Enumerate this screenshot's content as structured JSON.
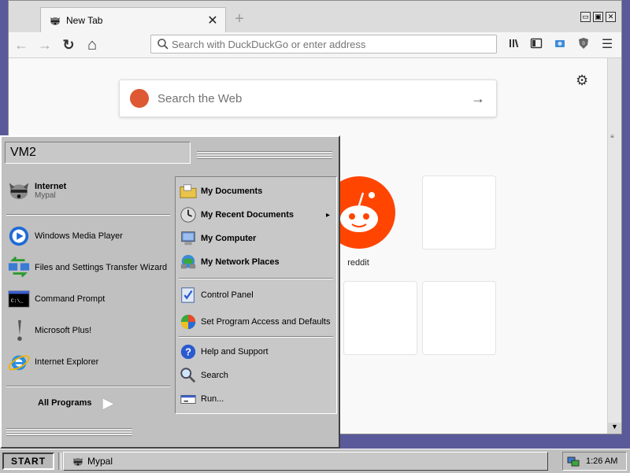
{
  "browser": {
    "tab": {
      "title": "New Tab",
      "close": "✕",
      "icon": "raccoon-icon"
    },
    "new_tab": "+",
    "window_controls": [
      "▭",
      "▣",
      "✕"
    ],
    "nav": {
      "back": "←",
      "forward": "→",
      "reload": "↻",
      "home": "⌂"
    },
    "url_placeholder": "Search with DuckDuckGo or enter address",
    "toolbar_icons": [
      "library-icon",
      "sidebar-icon",
      "screenshot-icon",
      "ublock-icon",
      "menu-icon"
    ]
  },
  "newtab": {
    "search_placeholder": "Search the Web",
    "search_arrow": "→",
    "settings": "⚙",
    "top_sites": [
      {
        "label": "reddit",
        "color": "#ff4500"
      }
    ]
  },
  "start_menu": {
    "user": "VM2",
    "pinned": [
      {
        "title": "Internet",
        "subtitle": "Mypal",
        "icon": "raccoon-icon"
      }
    ],
    "recent": [
      {
        "label": "Windows Media Player",
        "icon": "media-player-icon"
      },
      {
        "label": "Files and Settings Transfer Wizard",
        "icon": "transfer-wizard-icon"
      },
      {
        "label": "Command Prompt",
        "icon": "command-prompt-icon"
      },
      {
        "label": "Microsoft Plus!",
        "icon": "plus-icon"
      },
      {
        "label": "Internet Explorer",
        "icon": "internet-explorer-icon"
      }
    ],
    "all_programs": "All Programs",
    "right": [
      {
        "label": "My Documents",
        "bold": true,
        "icon": "folder-icon"
      },
      {
        "label": "My Recent Documents",
        "bold": true,
        "icon": "recent-docs-icon",
        "arrow": "▸"
      },
      {
        "label": "My Computer",
        "bold": true,
        "icon": "computer-icon"
      },
      {
        "label": "My Network Places",
        "bold": true,
        "icon": "network-icon"
      },
      {
        "label": "Control Panel",
        "bold": false,
        "icon": "control-panel-icon"
      },
      {
        "label": "Set Program Access and Defaults",
        "bold": false,
        "icon": "program-access-icon"
      },
      {
        "label": "Help and Support",
        "bold": false,
        "icon": "help-icon"
      },
      {
        "label": "Search",
        "bold": false,
        "icon": "search-icon"
      },
      {
        "label": "Run...",
        "bold": false,
        "icon": "run-icon"
      }
    ]
  },
  "taskbar": {
    "start": "START",
    "task": "Mypal",
    "clock": "1:26 AM"
  }
}
